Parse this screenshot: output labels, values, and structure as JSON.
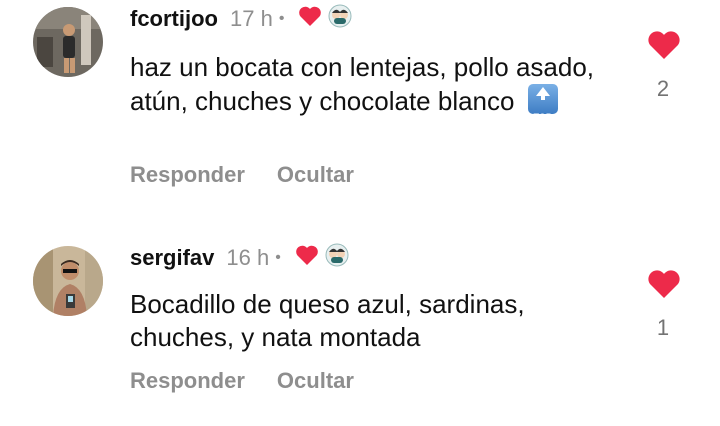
{
  "comments": [
    {
      "username": "fcortijoo",
      "time": "17 h",
      "dot": "•",
      "text": "haz un bocata con lentejas, pollo asado, atún, chuches y chocolate blanco",
      "emoji_label": "TOP",
      "likes": "2",
      "reply_label": "Responder",
      "hide_label": "Ocultar"
    },
    {
      "username": "sergifav",
      "time": "16 h",
      "dot": "•",
      "text": "Bocadillo de queso azul, sardinas, chuches, y nata montada",
      "likes": "1",
      "reply_label": "Responder",
      "hide_label": "Ocultar"
    }
  ],
  "icons": {
    "small_heart": "heart-icon",
    "creator_face": "creator-face-icon",
    "top_emoji": "top-arrow-emoji-icon",
    "like": "heart-icon"
  },
  "colors": {
    "heart": "#ed2a4a",
    "muted": "#8e8e8e"
  }
}
